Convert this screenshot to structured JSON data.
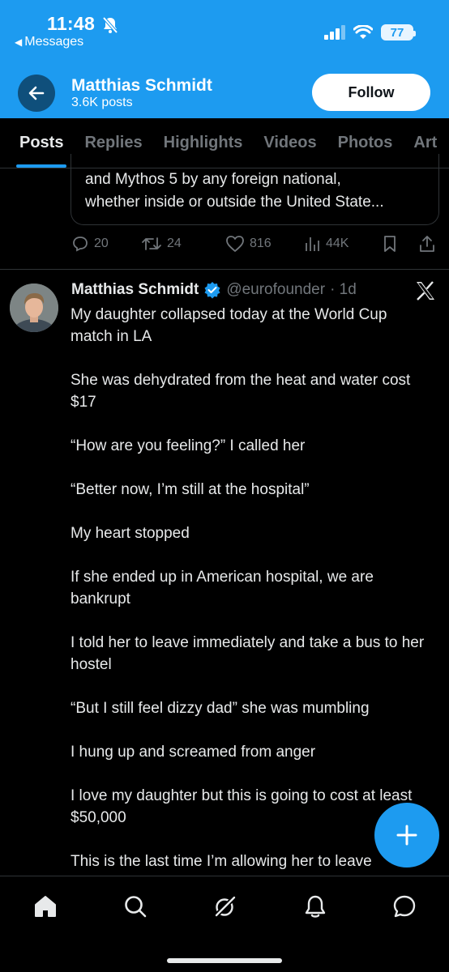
{
  "status_bar": {
    "time": "11:48",
    "back_app": "Messages",
    "battery": "77"
  },
  "header": {
    "name": "Matthias Schmidt",
    "posts_count": "3.6K posts",
    "follow_label": "Follow"
  },
  "tabs": [
    {
      "label": "Posts",
      "active": true
    },
    {
      "label": "Replies"
    },
    {
      "label": "Highlights"
    },
    {
      "label": "Videos"
    },
    {
      "label": "Photos"
    },
    {
      "label": "Art"
    }
  ],
  "previous_post": {
    "quote_lines": [
      "and Mythos 5 by any foreign national,",
      "whether inside or outside the United State..."
    ],
    "replies": "20",
    "reposts": "24",
    "likes": "816",
    "views": "44K"
  },
  "post": {
    "name": "Matthias Schmidt",
    "handle": "@eurofounder",
    "time": "· 1d",
    "paragraphs": [
      "My daughter collapsed today at the World Cup match in LA",
      "She was dehydrated from the heat and water cost $17",
      "“How are you feeling?” I called her",
      "“Better now, I’m still at the hospital”",
      "My heart stopped",
      "If she ended up in American hospital, we are bankrupt",
      "I told her to leave immediately and take a bus to her hostel",
      "“But I still feel dizzy dad” she was mumbling",
      "I hung up and screamed from anger",
      "I love my daughter but this is going to cost at least $50,000",
      "This is the last time I’m allowing her to leave"
    ]
  },
  "colors": {
    "accent": "#1d9bf0",
    "background": "#000000",
    "secondary_text": "#71767b"
  },
  "icons": [
    "back-arrow-icon",
    "home-icon",
    "search-icon",
    "grok-icon",
    "notifications-icon",
    "messages-icon",
    "compose-plus-icon",
    "x-logo-icon",
    "verified-badge-icon"
  ]
}
